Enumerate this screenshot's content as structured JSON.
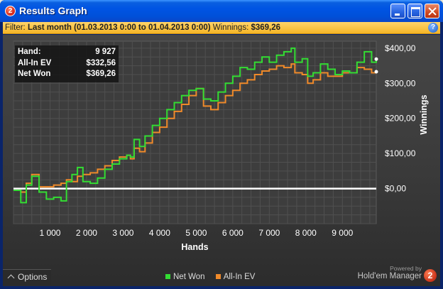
{
  "window": {
    "title": "Results Graph",
    "app_badge": "2"
  },
  "filter": {
    "label": "Filter:",
    "value": "Last month (01.03.2013 0:00 to 01.04.2013 0:00)",
    "winnings_label": "Winnings:",
    "winnings_value": "$369,26",
    "help": "?"
  },
  "stats": [
    {
      "label": "Hand:",
      "value": "9 927"
    },
    {
      "label": "All-In EV",
      "value": "$332,56"
    },
    {
      "label": "Net Won",
      "value": "$369,26"
    }
  ],
  "chart_data": {
    "type": "line",
    "xlabel": "Hands",
    "ylabel": "Winnings",
    "xlim": [
      0,
      9927
    ],
    "ylim": [
      -100,
      420
    ],
    "x_ticks": [
      1000,
      2000,
      3000,
      4000,
      5000,
      6000,
      7000,
      8000,
      9000
    ],
    "x_tick_labels": [
      "1 000",
      "2 000",
      "3 000",
      "4 000",
      "5 000",
      "6 000",
      "7 000",
      "8 000",
      "9 000"
    ],
    "y_ticks": [
      0,
      100,
      200,
      300,
      400
    ],
    "y_tick_labels": [
      "$0,00",
      "$100,00",
      "$200,00",
      "$300,00",
      "$400,00"
    ],
    "grid": true,
    "legend_position": "bottom",
    "series": [
      {
        "name": "Net Won",
        "color": "#33dd33",
        "x": [
          0,
          200,
          350,
          500,
          700,
          900,
          1100,
          1300,
          1450,
          1600,
          1750,
          1900,
          2100,
          2300,
          2500,
          2700,
          2900,
          3100,
          3200,
          3300,
          3450,
          3600,
          3800,
          4000,
          4200,
          4400,
          4600,
          4800,
          5000,
          5200,
          5400,
          5600,
          5800,
          6000,
          6200,
          6400,
          6600,
          6800,
          7000,
          7200,
          7400,
          7600,
          7700,
          7900,
          8050,
          8200,
          8400,
          8600,
          8800,
          9000,
          9200,
          9400,
          9600,
          9800,
          9927
        ],
        "values": [
          -5,
          -40,
          10,
          35,
          -10,
          -30,
          -25,
          -35,
          20,
          40,
          60,
          20,
          15,
          30,
          55,
          70,
          85,
          95,
          90,
          140,
          120,
          150,
          180,
          200,
          225,
          245,
          265,
          280,
          285,
          255,
          250,
          275,
          300,
          320,
          345,
          340,
          360,
          375,
          360,
          380,
          390,
          400,
          360,
          370,
          320,
          330,
          355,
          340,
          325,
          335,
          330,
          360,
          390,
          360,
          369
        ]
      },
      {
        "name": "All-In EV",
        "color": "#f08a2a",
        "x": [
          0,
          200,
          350,
          500,
          700,
          900,
          1100,
          1300,
          1450,
          1600,
          1750,
          1900,
          2100,
          2300,
          2500,
          2700,
          2900,
          3100,
          3200,
          3300,
          3450,
          3600,
          3800,
          4000,
          4200,
          4400,
          4600,
          4800,
          5000,
          5200,
          5400,
          5600,
          5800,
          6000,
          6200,
          6400,
          6600,
          6800,
          7000,
          7200,
          7400,
          7600,
          7700,
          7900,
          8050,
          8200,
          8400,
          8600,
          8800,
          9000,
          9200,
          9400,
          9600,
          9800,
          9927
        ],
        "values": [
          -5,
          -10,
          15,
          40,
          5,
          5,
          10,
          15,
          25,
          20,
          35,
          40,
          45,
          55,
          65,
          80,
          90,
          95,
          85,
          115,
          105,
          130,
          160,
          175,
          200,
          220,
          240,
          265,
          285,
          235,
          225,
          245,
          265,
          280,
          300,
          310,
          325,
          335,
          340,
          350,
          345,
          355,
          330,
          325,
          300,
          310,
          330,
          320,
          320,
          330,
          330,
          345,
          340,
          330,
          333
        ]
      }
    ]
  },
  "options": {
    "label": "Options"
  },
  "branding": {
    "powered_by": "Powered by",
    "name": "Hold'em Manager",
    "badge": "2"
  }
}
